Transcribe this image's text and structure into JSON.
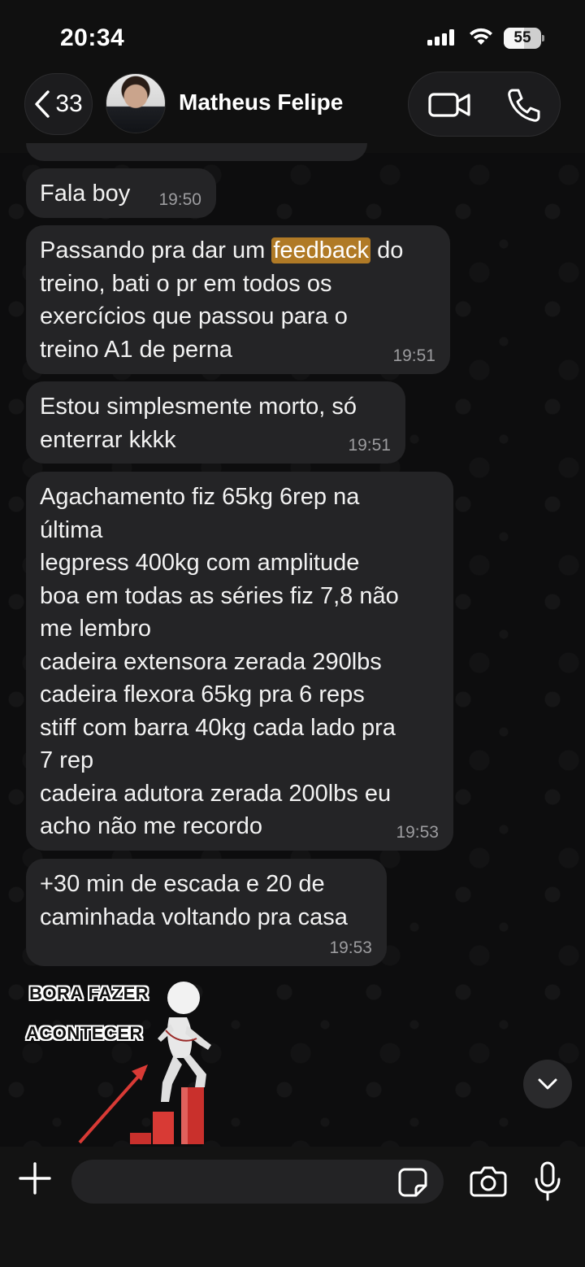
{
  "status_bar": {
    "time": "20:34",
    "battery_level": "55",
    "battery_fraction": 0.55,
    "icons": [
      "signal-icon",
      "wifi-icon",
      "battery-icon"
    ]
  },
  "header": {
    "back_count": "33",
    "contact_name": "Matheus Felipe",
    "icons": [
      "chevron-left-icon",
      "video-camera-icon",
      "phone-icon"
    ]
  },
  "messages": [
    {
      "text": "Fala boy",
      "time": "19:50"
    },
    {
      "text_before": "Passando pra dar um ",
      "highlight": "feedback",
      "text_after": " do\ntreino, bati o pr em todos os\nexercícios que passou para o\ntreino A1 de perna",
      "time": "19:51"
    },
    {
      "text": "Estou simplesmente morto, só\nenterrar kkkk",
      "time": "19:51"
    },
    {
      "text": "Agachamento fiz 65kg 6rep na\núltima\nlegpress 400kg com amplitude\nboa em todas as séries fiz 7,8 não\nme lembro\ncadeira extensora zerada 290lbs\ncadeira flexora 65kg pra 6 reps\nstiff com barra 40kg cada lado pra\n7 rep\ncadeira adutora zerada 200lbs eu\nacho não me recordo",
      "time": "19:53"
    },
    {
      "text": "+30 min de escada e 20 de\ncaminhada voltando pra casa",
      "time": "19:53"
    }
  ],
  "sticker": {
    "line1": "BORA FAZER",
    "line2": "ACONTECER"
  },
  "input_bar": {
    "placeholder": "",
    "icons": [
      "plus-icon",
      "sticker-icon",
      "camera-icon",
      "microphone-icon"
    ]
  },
  "colors": {
    "bubble": "#242426",
    "highlight": "#b07a26",
    "timestamp": "#9c9c9f"
  }
}
